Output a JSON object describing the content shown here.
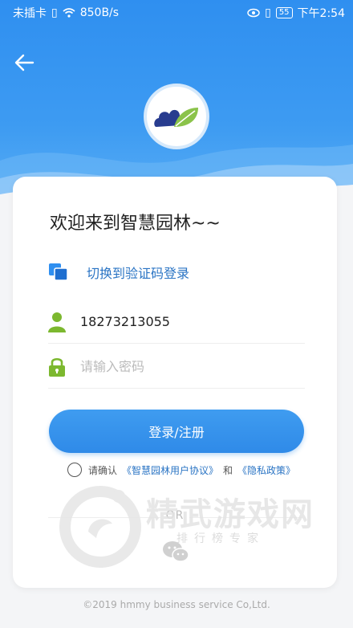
{
  "status_bar": {
    "carrier": "未插卡",
    "speed": "850B/s",
    "battery": "55",
    "time": "下午2:54"
  },
  "header": {
    "back_icon": "arrow-left-icon",
    "logo_icon": "cloud-leaf-logo-icon"
  },
  "card": {
    "welcome": "欢迎来到智慧园林~~",
    "switch_mode_label": "切换到验证码登录",
    "phone_value": "18273213055",
    "password_placeholder": "请输入密码",
    "login_button": "登录/注册",
    "agree_prefix": "请确认",
    "agreement_link": "《智慧园林用户协议》",
    "agree_and": "和",
    "privacy_link": "《隐私政策》",
    "or_label": "OR",
    "wechat_icon": "wechat-icon"
  },
  "watermark": {
    "title": "精武游戏网",
    "subtitle": "排行榜专家"
  },
  "footer": {
    "copyright": "©2019 hmmy business service Co,Ltd."
  },
  "colors": {
    "primary": "#2f8ff0",
    "link": "#2a74c4",
    "icon_green": "#7cb82f"
  }
}
